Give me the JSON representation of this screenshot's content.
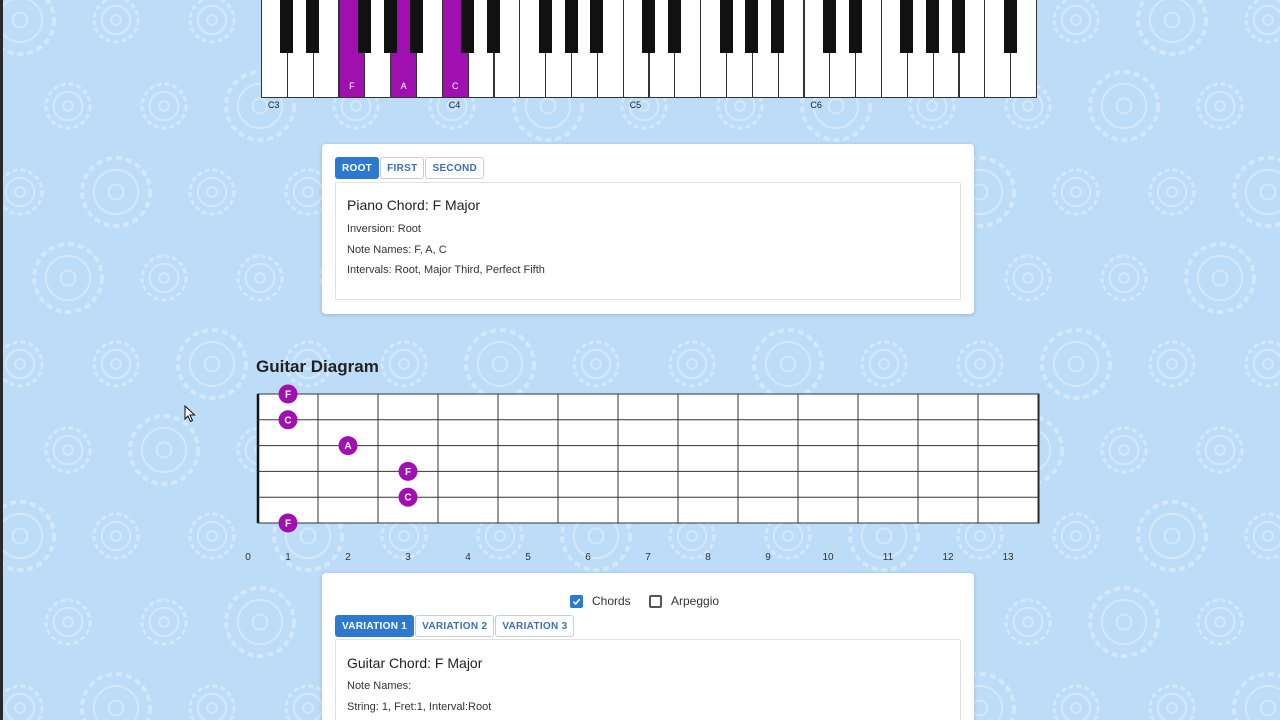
{
  "piano": {
    "active_notes": [
      "F",
      "A",
      "C"
    ],
    "octave_labels": [
      "C3",
      "C4",
      "C5",
      "C6"
    ]
  },
  "piano_card": {
    "tabs": [
      {
        "label": "ROOT",
        "selected": true
      },
      {
        "label": "FIRST",
        "selected": false
      },
      {
        "label": "SECOND",
        "selected": false
      }
    ],
    "title": "Piano Chord: F Major",
    "inversion": "Inversion: Root",
    "note_names": "Note Names: F, A, C",
    "intervals": "Intervals: Root, Major Third, Perfect Fifth"
  },
  "guitar": {
    "heading": "Guitar Diagram",
    "fret_numbers": [
      "0",
      "1",
      "2",
      "3",
      "4",
      "5",
      "6",
      "7",
      "8",
      "9",
      "10",
      "11",
      "12",
      "13"
    ],
    "notes": [
      {
        "string": 1,
        "fret": 1,
        "label": "F"
      },
      {
        "string": 2,
        "fret": 1,
        "label": "C"
      },
      {
        "string": 3,
        "fret": 2,
        "label": "A"
      },
      {
        "string": 4,
        "fret": 3,
        "label": "F"
      },
      {
        "string": 5,
        "fret": 3,
        "label": "C"
      },
      {
        "string": 6,
        "fret": 1,
        "label": "F"
      }
    ],
    "note_color": "#a010b0"
  },
  "guitar_card": {
    "chords_label": "Chords",
    "chords_checked": true,
    "arpeggio_label": "Arpeggio",
    "arpeggio_checked": false,
    "tabs": [
      {
        "label": "VARIATION 1",
        "selected": true
      },
      {
        "label": "VARIATION 2",
        "selected": false
      },
      {
        "label": "VARIATION 3",
        "selected": false
      }
    ],
    "title": "Guitar Chord: F Major",
    "note_names": "Note Names:",
    "string_line": "String: 1, Fret:1, Interval:Root"
  },
  "colors": {
    "background": "#bcdcf7",
    "accent": "#2e79d0",
    "highlight": "#a010b0"
  }
}
